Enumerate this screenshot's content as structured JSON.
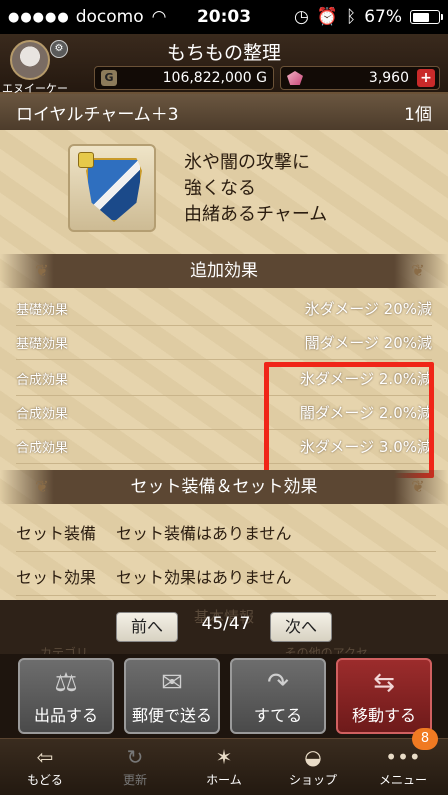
{
  "statusbar": {
    "carrier": "docomo",
    "time": "20:03",
    "battery": "67%",
    "battery_level": 0.67
  },
  "header": {
    "title": "もちもの整理",
    "player_name": "エヌイーケー",
    "gold": "106,822,000 G",
    "gold_icon": "G",
    "gems": "3,960",
    "gems_add": "+"
  },
  "item": {
    "name": "ロイヤルチャーム＋3",
    "count": "1個",
    "description": [
      "氷や闇の攻撃に",
      "強くなる",
      "由緒あるチャーム"
    ]
  },
  "extra_effects": {
    "title": "追加効果",
    "rows": [
      {
        "label": "基礎効果",
        "value": "氷ダメージ 20%減"
      },
      {
        "label": "基礎効果",
        "value": "闇ダメージ 20%減"
      },
      {
        "label": "合成効果",
        "value": "氷ダメージ 2.0%減"
      },
      {
        "label": "合成効果",
        "value": "闇ダメージ 2.0%減"
      },
      {
        "label": "合成効果",
        "value": "氷ダメージ 3.0%減"
      }
    ]
  },
  "set_effects": {
    "title": "セット装備＆セット効果",
    "rows": [
      {
        "label": "セット装備",
        "value": "セット装備はありません"
      },
      {
        "label": "セット効果",
        "value": "セット効果はありません"
      }
    ]
  },
  "pager": {
    "prev": "前へ",
    "next": "次へ",
    "page": "45/47",
    "ghost_title": "基本情報",
    "ghost_left": "カテゴリ",
    "ghost_right": "その他のアクセ"
  },
  "actions": [
    {
      "label": "出品する",
      "icon": "scales-icon"
    },
    {
      "label": "郵便で送る",
      "icon": "mail-icon"
    },
    {
      "label": "すてる",
      "icon": "discard-icon"
    },
    {
      "label": "移動する",
      "icon": "transfer-icon"
    }
  ],
  "nav": {
    "items": [
      {
        "label": "もどる",
        "icon": "back-icon"
      },
      {
        "label": "更新",
        "icon": "refresh-icon"
      },
      {
        "label": "ホーム",
        "icon": "home-icon"
      },
      {
        "label": "ショップ",
        "icon": "shop-icon"
      },
      {
        "label": "メニュー",
        "icon": "menu-icon"
      }
    ],
    "badge": "8"
  },
  "colors": {
    "highlight": "#f02518",
    "accent_red": "#c92a2a",
    "badge": "#f07a22"
  }
}
